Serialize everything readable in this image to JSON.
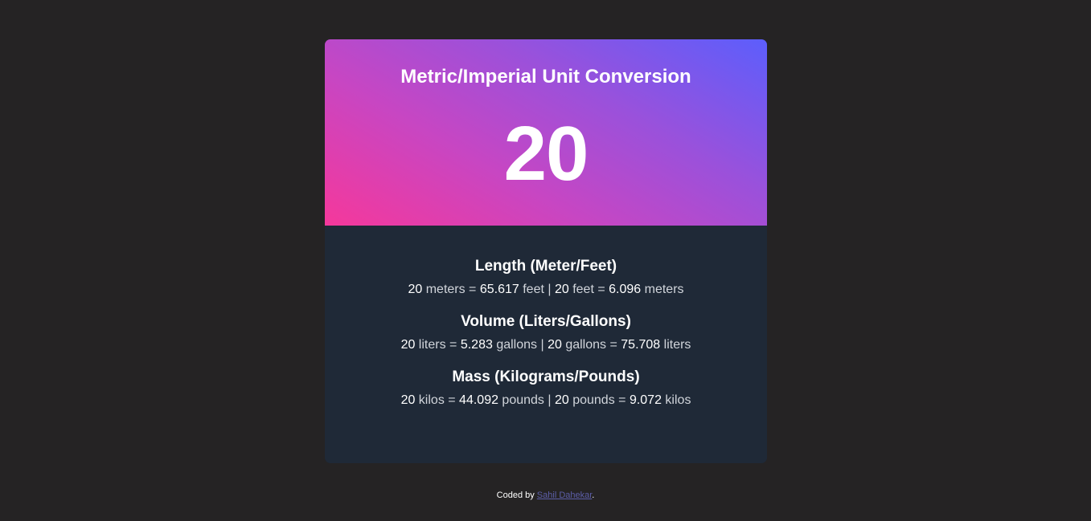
{
  "header": {
    "title": "Metric/Imperial Unit Conversion",
    "value": "20"
  },
  "sections": [
    {
      "heading": "Length (Meter/Feet)",
      "parts": [
        {
          "t": "20",
          "num": true
        },
        {
          "t": " meters = ",
          "num": false
        },
        {
          "t": "65.617",
          "num": true
        },
        {
          "t": " feet | ",
          "num": false
        },
        {
          "t": "20",
          "num": true
        },
        {
          "t": " feet = ",
          "num": false
        },
        {
          "t": "6.096",
          "num": true
        },
        {
          "t": " meters",
          "num": false
        }
      ]
    },
    {
      "heading": "Volume (Liters/Gallons)",
      "parts": [
        {
          "t": "20",
          "num": true
        },
        {
          "t": " liters = ",
          "num": false
        },
        {
          "t": "5.283",
          "num": true
        },
        {
          "t": " gallons | ",
          "num": false
        },
        {
          "t": "20",
          "num": true
        },
        {
          "t": " gallons = ",
          "num": false
        },
        {
          "t": "75.708",
          "num": true
        },
        {
          "t": " liters",
          "num": false
        }
      ]
    },
    {
      "heading": "Mass (Kilograms/Pounds)",
      "parts": [
        {
          "t": "20",
          "num": true
        },
        {
          "t": " kilos = ",
          "num": false
        },
        {
          "t": "44.092",
          "num": true
        },
        {
          "t": " pounds | ",
          "num": false
        },
        {
          "t": "20",
          "num": true
        },
        {
          "t": " pounds = ",
          "num": false
        },
        {
          "t": "9.072",
          "num": true
        },
        {
          "t": " kilos",
          "num": false
        }
      ]
    }
  ],
  "footer": {
    "prefix": "Coded by ",
    "author": "Sahil Dahekar",
    "suffix": "."
  },
  "colors": {
    "page_background": "#252324",
    "card_body": "#1f2937",
    "gradient_start": "#f5389b",
    "gradient_end": "#5c5efc",
    "link": "#5c5ea8"
  }
}
